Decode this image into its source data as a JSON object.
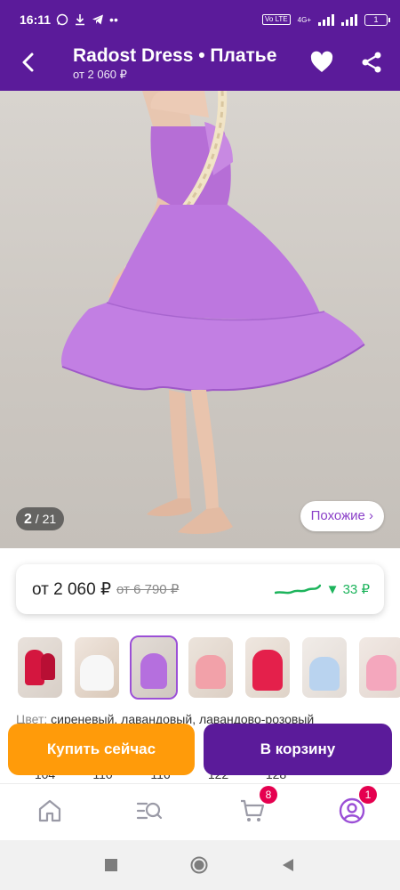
{
  "status_bar": {
    "time": "16:11",
    "network": "4G+",
    "volte": "Vo LTE",
    "battery": "1"
  },
  "app_bar": {
    "title": "Radost Dress • Платье",
    "subtitle": "от 2 060 ₽",
    "icons": [
      "back-arrow-icon",
      "heart-icon",
      "share-icon"
    ]
  },
  "gallery": {
    "counter_current": "2",
    "counter_total": "/ 21",
    "similar_label": "Похожие ›"
  },
  "price": {
    "current": "от 2 060 ₽",
    "old": "от 6 790 ₽",
    "drop": "▼ 33 ₽",
    "drop_color": "#1db45c"
  },
  "thumbnails": [
    {
      "label": "red dress",
      "active": false
    },
    {
      "label": "white dress",
      "active": false
    },
    {
      "label": "lilac dress",
      "active": true
    },
    {
      "label": "pink dress",
      "active": false
    },
    {
      "label": "red bow dress",
      "active": false
    },
    {
      "label": "blue dress",
      "active": false
    },
    {
      "label": "pink dress 2",
      "active": false
    }
  ],
  "color_line": {
    "label": "Цвет:",
    "value": "сиреневый, лавандовый, лавандово-розовый"
  },
  "sizes": [
    "104",
    "110",
    "116",
    "122",
    "128"
  ],
  "actions": {
    "buy_now": "Купить сейчас",
    "add_to_cart": "В корзину"
  },
  "bottom_nav": {
    "items": [
      "home-icon",
      "catalog-search-icon",
      "cart-icon",
      "profile-icon"
    ],
    "cart_badge": "8",
    "profile_badge": "1"
  },
  "colors": {
    "brand": "#5b1b9a",
    "buy": "#ff9b0a",
    "badge": "#e5004f",
    "accent": "#9b4fd6"
  }
}
